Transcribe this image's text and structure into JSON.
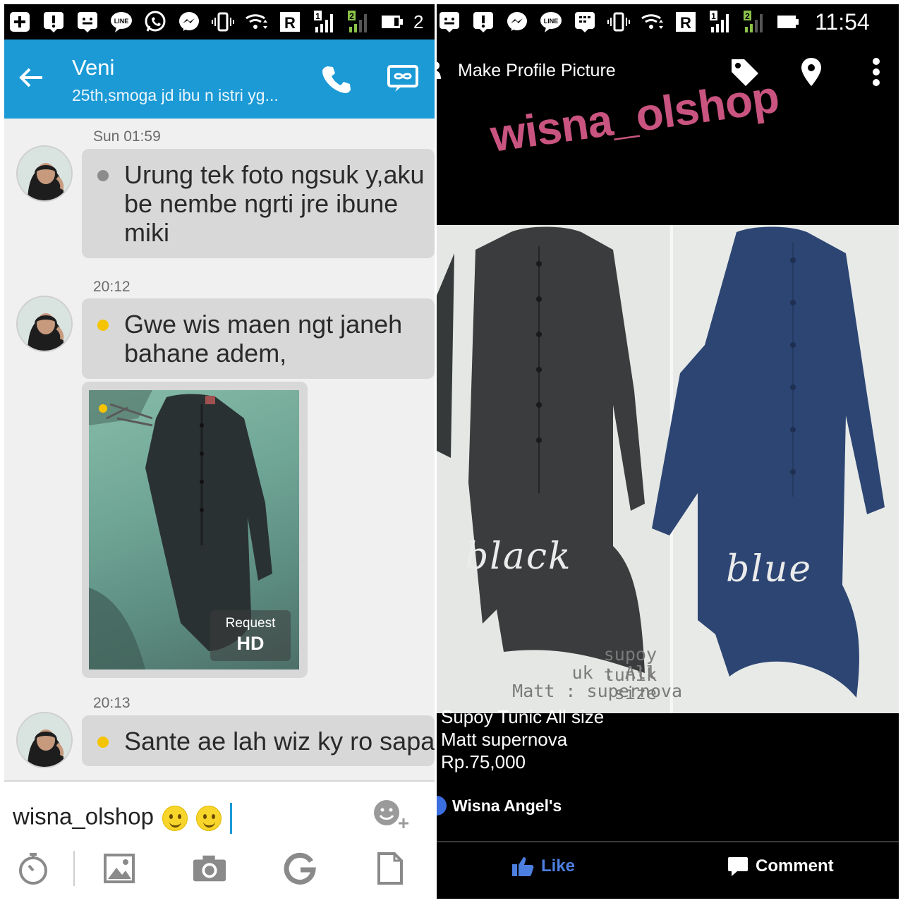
{
  "left_screen": {
    "status_bar": {
      "icons": [
        "plus-icon",
        "alert-icon",
        "sms-icon",
        "line-icon",
        "whatsapp-icon",
        "messenger-icon",
        "vibrate-icon",
        "wifi-icon",
        "roaming-r-icon",
        "signal-sim1-icon",
        "signal-sim2-icon",
        "battery-icon"
      ]
    },
    "header": {
      "contact_name": "Veni",
      "contact_status": "25th,smoga jd ibu n istri yg...",
      "accent_color": "#1b9ad6"
    },
    "messages": [
      {
        "time": "Sun 01:59",
        "text": "Urung tek foto ngsuk y,aku be nembe ngrti jre ibune miki",
        "dot_color": "#8c8c8c"
      },
      {
        "time": "20:12",
        "text": "Gwe wis maen ngt janeh bahane adem,",
        "dot_color": "#f5c400"
      },
      {
        "type": "image",
        "request_label": "Request",
        "hd_label": "HD"
      },
      {
        "time": "20:13",
        "text": "Sante ae lah wiz ky ro sapa",
        "dot_color": "#f5c400"
      }
    ],
    "input": {
      "value": "wisna_olshop"
    },
    "toolbar": [
      "timer-icon",
      "gallery-icon",
      "camera-icon",
      "g-icon",
      "file-icon"
    ]
  },
  "right_screen": {
    "status_bar": {
      "time": "11:54",
      "icons": [
        "sms-icon",
        "alert-icon",
        "messenger-icon",
        "line-icon",
        "bbm-icon",
        "vibrate-icon",
        "wifi-icon",
        "roaming-r-icon",
        "signal-sim1-icon",
        "signal-sim2-icon",
        "battery-icon"
      ]
    },
    "header": {
      "title": "Make Profile Picture"
    },
    "watermark": "wisna_olshop",
    "photo": {
      "label_left": "black",
      "label_right": "blue",
      "caption_lines": [
        "supoy tunik",
        "uk : All size",
        "Matt : supernova"
      ]
    },
    "post_caption": [
      "Supoy Tunic All size",
      "Matt supernova",
      "Rp.75,000"
    ],
    "author": "Wisna Angel's",
    "actions": {
      "like": "Like",
      "comment": "Comment"
    },
    "colors": {
      "watermark": "#c9547f",
      "like": "#4c7fe0"
    }
  }
}
